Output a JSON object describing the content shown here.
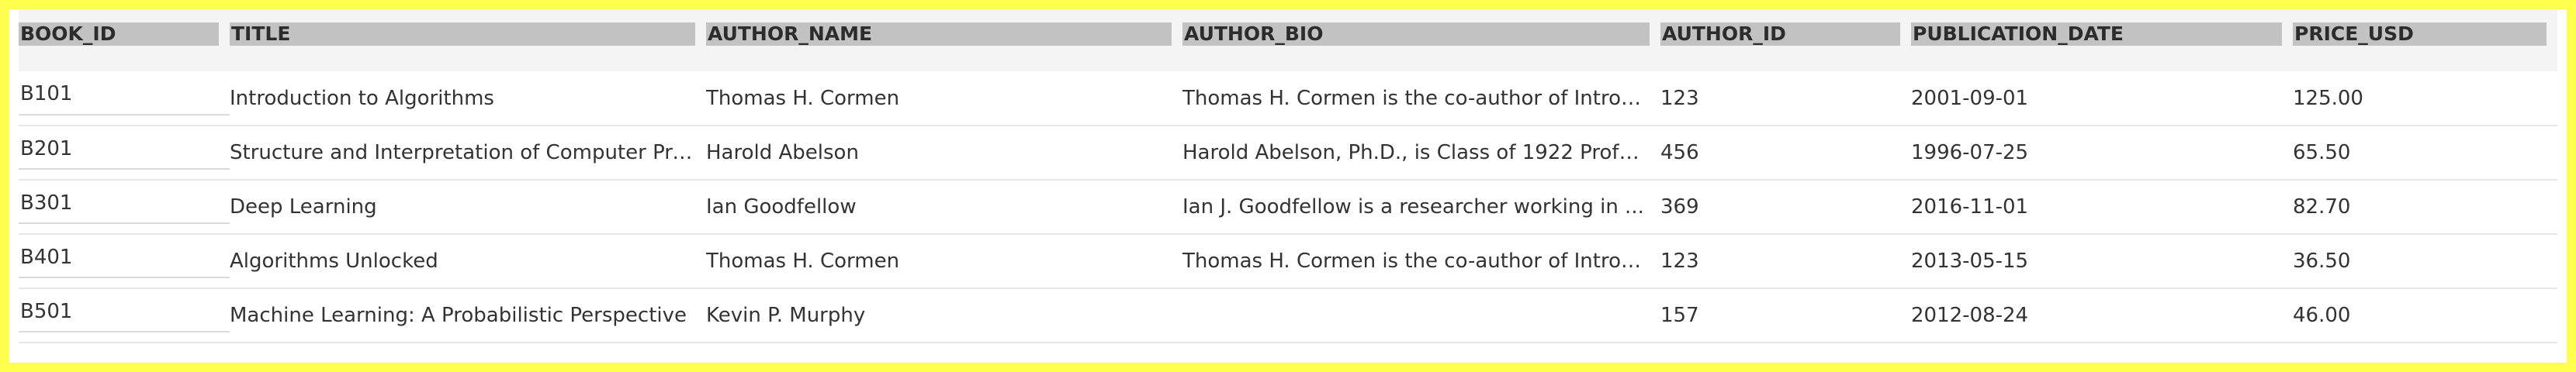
{
  "table": {
    "columns": [
      "BOOK_ID",
      "TITLE",
      "AUTHOR_NAME",
      "AUTHOR_BIO",
      "AUTHOR_ID",
      "PUBLICATION_DATE",
      "PRICE_USD"
    ],
    "rows": [
      [
        "B101",
        "Introduction to Algorithms",
        "Thomas H. Cormen",
        "Thomas H. Cormen is the co-author of Introd...",
        "123",
        "2001-09-01",
        "125.00"
      ],
      [
        "B201",
        "Structure and Interpretation of Computer Pro...",
        "Harold Abelson",
        "Harold Abelson, Ph.D., is Class of 1922 Profe...",
        "456",
        "1996-07-25",
        "65.50"
      ],
      [
        "B301",
        "Deep Learning",
        "Ian Goodfellow",
        "Ian J. Goodfellow is a researcher working in ...",
        "369",
        "2016-11-01",
        "82.70"
      ],
      [
        "B401",
        "Algorithms Unlocked",
        "Thomas H. Cormen",
        "Thomas H. Cormen is the co-author of Introd...",
        "123",
        "2013-05-15",
        "36.50"
      ],
      [
        "B501",
        "Machine Learning: A Probabilistic Perspective",
        "Kevin P. Murphy",
        "",
        "157",
        "2012-08-24",
        "46.00"
      ]
    ]
  }
}
